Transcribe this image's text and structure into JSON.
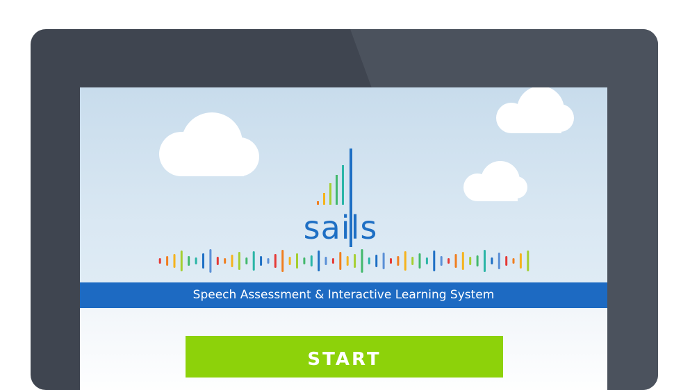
{
  "app": {
    "logo_text": "sails",
    "tagline": "Speech Assessment & Interactive Learning System",
    "start_label": "START"
  },
  "colors": {
    "device_bezel": "#3f4550",
    "brand_blue": "#1d6ac2",
    "start_green": "#8dd20a",
    "sky_top": "#c8dcec"
  },
  "icons": {
    "logo_bars": "sound-level-bars-icon",
    "waveform": "audio-waveform-icon"
  }
}
